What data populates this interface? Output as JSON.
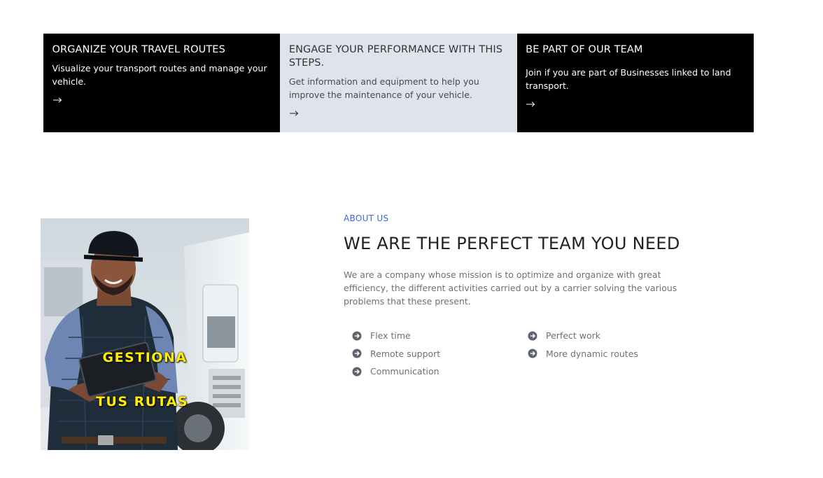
{
  "cards": [
    {
      "title": "ORGANIZE YOUR TRAVEL ROUTES",
      "text": "Visualize your transport routes and manage your vehicle.",
      "theme": "dark",
      "arrow_icon": "arrow-right-icon"
    },
    {
      "title": "ENGAGE YOUR PERFORMANCE WITH THIS STEPS.",
      "text": "Get information and equipment to help you improve the maintenance of your vehicle.",
      "theme": "light",
      "arrow_icon": "arrow-right-icon"
    },
    {
      "title": "BE PART OF OUR TEAM",
      "text": "Join if you are part of Businesses linked to land transport.",
      "theme": "dark",
      "arrow_icon": "arrow-right-icon"
    }
  ],
  "about": {
    "eyebrow": "ABOUT US",
    "heading": "WE ARE THE PERFECT TEAM YOU NEED",
    "description": "We are a company whose mission is to optimize and organize with great efficiency, the different activities carried out by a carrier solving the various problems that these present.",
    "image_text_line1": "GESTIONA",
    "image_text_line2": "TUS RUTAS",
    "features": [
      "Flex time",
      "Perfect work",
      "Remote support",
      "More dynamic routes",
      "Communication"
    ],
    "feature_icon": "circle-arrow-right-icon"
  },
  "colors": {
    "card_dark": "#000000",
    "card_light": "#dfe3ec",
    "accent": "#3c6ad3",
    "image_text": "#ffee00",
    "icon": "#5d6470"
  }
}
